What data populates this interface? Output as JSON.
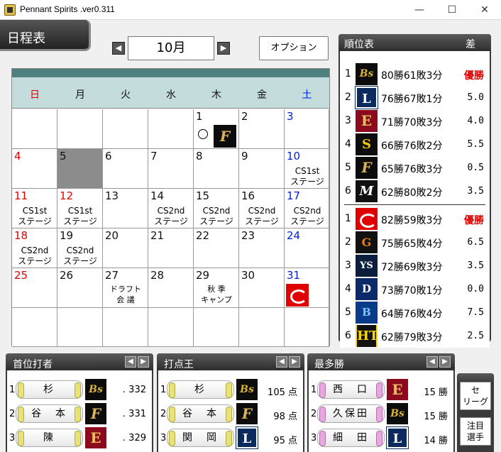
{
  "window": {
    "title": "Pennant Spirits .ver0.311",
    "minimize": "—",
    "maximize": "☐",
    "close": "✕"
  },
  "page": {
    "tab_label": "日程表"
  },
  "month_nav": {
    "prev": "◀",
    "month": "10月",
    "next": "▶"
  },
  "toolbar": {
    "options_label": "オプション"
  },
  "calendar": {
    "weekdays": [
      "日",
      "月",
      "火",
      "水",
      "木",
      "金",
      "土"
    ],
    "days": [
      {
        "d": "1",
        "col": 4,
        "row": 0,
        "circle": true,
        "logo": "F"
      },
      {
        "d": "2",
        "col": 5,
        "row": 0
      },
      {
        "d": "3",
        "col": 6,
        "row": 0
      },
      {
        "d": "4",
        "col": 0,
        "row": 1
      },
      {
        "d": "5",
        "col": 1,
        "row": 1,
        "today": true
      },
      {
        "d": "6",
        "col": 2,
        "row": 1
      },
      {
        "d": "7",
        "col": 3,
        "row": 1
      },
      {
        "d": "8",
        "col": 4,
        "row": 1
      },
      {
        "d": "9",
        "col": 5,
        "row": 1
      },
      {
        "d": "10",
        "col": 6,
        "row": 1,
        "event": "CS1st\nステージ"
      },
      {
        "d": "11",
        "col": 0,
        "row": 2,
        "event": "CS1st\nステージ"
      },
      {
        "d": "12",
        "col": 1,
        "row": 2,
        "event": "CS1st\nステージ",
        "red": true
      },
      {
        "d": "13",
        "col": 2,
        "row": 2
      },
      {
        "d": "14",
        "col": 3,
        "row": 2,
        "event": "CS2nd\nステージ"
      },
      {
        "d": "15",
        "col": 4,
        "row": 2,
        "event": "CS2nd\nステージ"
      },
      {
        "d": "16",
        "col": 5,
        "row": 2,
        "event": "CS2nd\nステージ"
      },
      {
        "d": "17",
        "col": 6,
        "row": 2,
        "event": "CS2nd\nステージ"
      },
      {
        "d": "18",
        "col": 0,
        "row": 3,
        "event": "CS2nd\nステージ"
      },
      {
        "d": "19",
        "col": 1,
        "row": 3,
        "event": "CS2nd\nステージ"
      },
      {
        "d": "20",
        "col": 2,
        "row": 3
      },
      {
        "d": "21",
        "col": 3,
        "row": 3
      },
      {
        "d": "22",
        "col": 4,
        "row": 3
      },
      {
        "d": "23",
        "col": 5,
        "row": 3
      },
      {
        "d": "24",
        "col": 6,
        "row": 3
      },
      {
        "d": "25",
        "col": 0,
        "row": 4
      },
      {
        "d": "26",
        "col": 1,
        "row": 4
      },
      {
        "d": "27",
        "col": 2,
        "row": 4,
        "event": "ドラフト\n会 議"
      },
      {
        "d": "28",
        "col": 3,
        "row": 4
      },
      {
        "d": "29",
        "col": 4,
        "row": 4,
        "event": "秋 季\nキャンプ"
      },
      {
        "d": "30",
        "col": 5,
        "row": 4
      },
      {
        "d": "31",
        "col": 6,
        "row": 4,
        "logo": "C"
      }
    ]
  },
  "standings": {
    "title": "順位表",
    "diff_label": "差",
    "pacific": [
      {
        "rank": "1",
        "logo": "Bs",
        "record": "80勝61敗3分",
        "diff": "優勝"
      },
      {
        "rank": "2",
        "logo": "L",
        "record": "76勝67敗1分",
        "diff": "5.0"
      },
      {
        "rank": "3",
        "logo": "E",
        "record": "71勝70敗3分",
        "diff": "4.0"
      },
      {
        "rank": "4",
        "logo": "H",
        "record": "66勝76敗2分",
        "diff": "5.5"
      },
      {
        "rank": "5",
        "logo": "F",
        "record": "65勝76敗3分",
        "diff": "0.5"
      },
      {
        "rank": "6",
        "logo": "M",
        "record": "62勝80敗2分",
        "diff": "3.5"
      }
    ],
    "central": [
      {
        "rank": "1",
        "logo": "C",
        "record": "82勝59敗3分",
        "diff": "優勝"
      },
      {
        "rank": "2",
        "logo": "G",
        "record": "75勝65敗4分",
        "diff": "6.5"
      },
      {
        "rank": "3",
        "logo": "YS",
        "record": "72勝69敗3分",
        "diff": "3.5"
      },
      {
        "rank": "4",
        "logo": "D",
        "record": "73勝70敗1分",
        "diff": "0.0"
      },
      {
        "rank": "5",
        "logo": "DB",
        "record": "64勝76敗4分",
        "diff": "7.5"
      },
      {
        "rank": "6",
        "logo": "T",
        "record": "62勝79敗3分",
        "diff": "2.5"
      }
    ]
  },
  "logos": {
    "Bs": {
      "text": "Bs"
    },
    "L": {
      "text": "L"
    },
    "E": {
      "text": "E"
    },
    "H": {
      "text": "S"
    },
    "F": {
      "text": "F"
    },
    "M": {
      "text": "M"
    },
    "C": {
      "text": ""
    },
    "G": {
      "text": "G"
    },
    "YS": {
      "text": "YS"
    },
    "D": {
      "text": "D"
    },
    "DB": {
      "text": "B"
    },
    "T": {
      "text": "HT"
    }
  },
  "leaders": [
    {
      "title": "首位打者",
      "left_arrow": "◀",
      "right_arrow": "▶",
      "style": "y",
      "rows": [
        {
          "rank": "1",
          "name": "杉",
          "logo": "Bs",
          "value": ". 332"
        },
        {
          "rank": "2",
          "name": "谷　本",
          "logo": "F",
          "value": ". 331"
        },
        {
          "rank": "3",
          "name": "陳",
          "logo": "E",
          "value": ". 329"
        }
      ]
    },
    {
      "title": "打点王",
      "left_arrow": "◀",
      "right_arrow": "▶",
      "style": "y",
      "rows": [
        {
          "rank": "1",
          "name": "杉",
          "logo": "Bs",
          "value": "105 点"
        },
        {
          "rank": "2",
          "name": "谷　本",
          "logo": "F",
          "value": "98 点"
        },
        {
          "rank": "3",
          "name": "関　岡",
          "logo": "L",
          "value": "95 点"
        }
      ]
    },
    {
      "title": "最多勝",
      "left_arrow": "◀",
      "right_arrow": "▶",
      "style": "p",
      "rows": [
        {
          "rank": "1",
          "name": "西　口",
          "logo": "E",
          "value": "15 勝"
        },
        {
          "rank": "2",
          "name": "久保田",
          "logo": "Bs",
          "value": "15 勝"
        },
        {
          "rank": "3",
          "name": "細　田",
          "logo": "L",
          "value": "14 勝"
        }
      ]
    }
  ],
  "side_buttons": [
    {
      "label": "セ\nリーグ"
    },
    {
      "label": "注目\n選手"
    }
  ]
}
